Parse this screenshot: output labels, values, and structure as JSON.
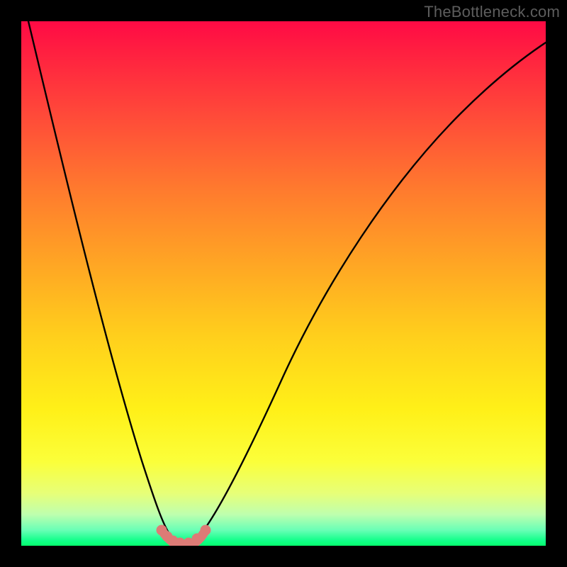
{
  "attribution": "TheBottleneck.com",
  "chart_data": {
    "type": "line",
    "title": "",
    "xlabel": "",
    "ylabel": "",
    "series": [
      {
        "name": "curve",
        "x": [
          0.0,
          0.05,
          0.1,
          0.15,
          0.2,
          0.24,
          0.26,
          0.28,
          0.3,
          0.32,
          0.34,
          0.4,
          0.5,
          0.6,
          0.7,
          0.8,
          0.9,
          1.0
        ],
        "y": [
          1.0,
          0.82,
          0.64,
          0.46,
          0.28,
          0.1,
          0.03,
          0.0,
          0.0,
          0.03,
          0.1,
          0.3,
          0.52,
          0.67,
          0.78,
          0.86,
          0.92,
          0.97
        ]
      },
      {
        "name": "bottom-markers",
        "x": [
          0.255,
          0.265,
          0.275,
          0.285,
          0.3,
          0.32,
          0.34
        ],
        "y": [
          0.03,
          0.02,
          0.01,
          0.005,
          0.005,
          0.012,
          0.028
        ]
      }
    ],
    "xlim": [
      0,
      1
    ],
    "ylim": [
      0,
      1
    ],
    "grid": false,
    "legend": false
  },
  "colors": {
    "curve_stroke": "#000000",
    "marker_fill": "#dd7b76",
    "attribution_text": "#5d5d5d",
    "frame_background": "#000000"
  }
}
